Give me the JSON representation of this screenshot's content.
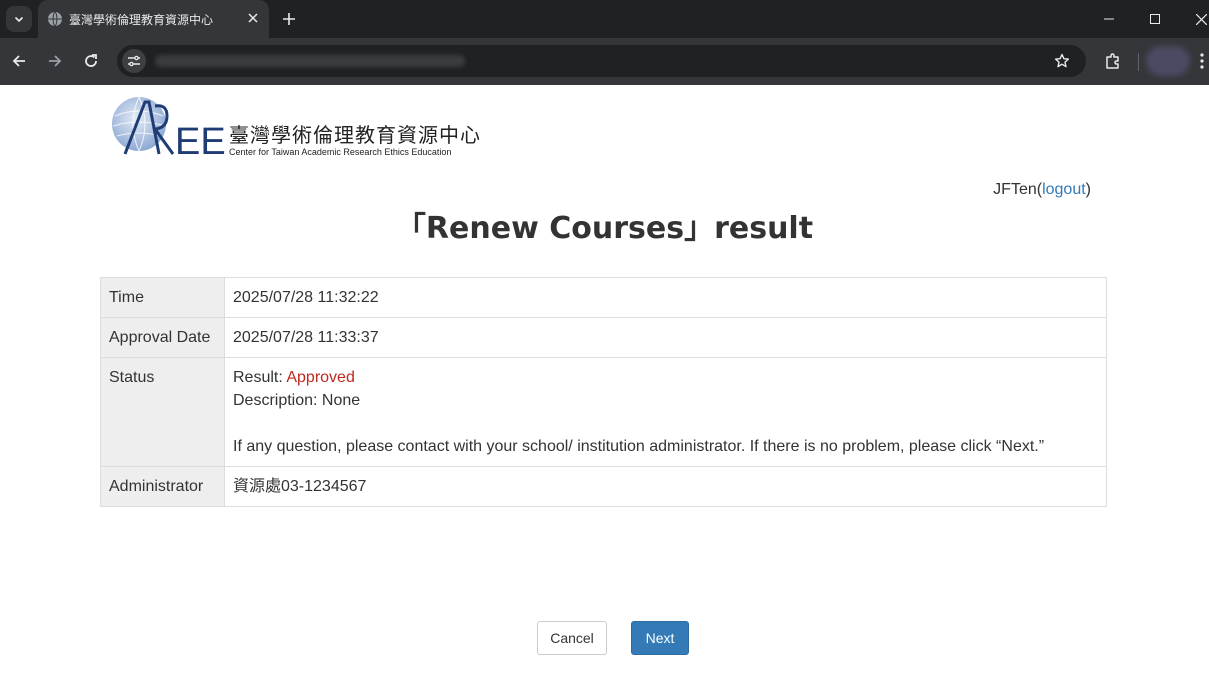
{
  "browser": {
    "tab_title": "臺灣學術倫理教育資源中心",
    "icons": {
      "tab_menu": "chevron-down-icon",
      "favicon": "globe-icon",
      "tab_close": "close-icon",
      "new_tab": "plus-icon",
      "minimize": "minimize-icon",
      "maximize": "maximize-icon",
      "close_window": "close-icon",
      "back": "arrow-left-icon",
      "forward": "arrow-right-icon",
      "reload": "reload-icon",
      "site_info": "tune-icon",
      "bookmark": "star-icon",
      "extensions": "puzzle-icon",
      "menu": "more-vertical-icon"
    }
  },
  "header": {
    "logo_cn": "臺灣學術倫理教育資源中心",
    "logo_en": "Center for Taiwan Academic Research Ethics Education",
    "username": "JFTen",
    "logout_label": "logout"
  },
  "main": {
    "title": "「Renew Courses」result",
    "rows": {
      "time": {
        "label": "Time",
        "value": "2025/07/28 11:32:22"
      },
      "approval_date": {
        "label": "Approval Date",
        "value": "2025/07/28 11:33:37"
      },
      "status": {
        "label": "Status",
        "result_label": "Result: ",
        "result_value": "Approved",
        "description": "Description: None",
        "note": "If any question, please contact with your school/ institution administrator. If there is no problem, please click “Next.”"
      },
      "administrator": {
        "label": "Administrator",
        "value": "資源處03-1234567"
      }
    }
  },
  "actions": {
    "cancel_label": "Cancel",
    "next_label": "Next"
  },
  "colors": {
    "approved": "#c0281e",
    "primary_button": "#337ab7",
    "link": "#337ab7",
    "label_cell_bg": "#eeeeee"
  }
}
